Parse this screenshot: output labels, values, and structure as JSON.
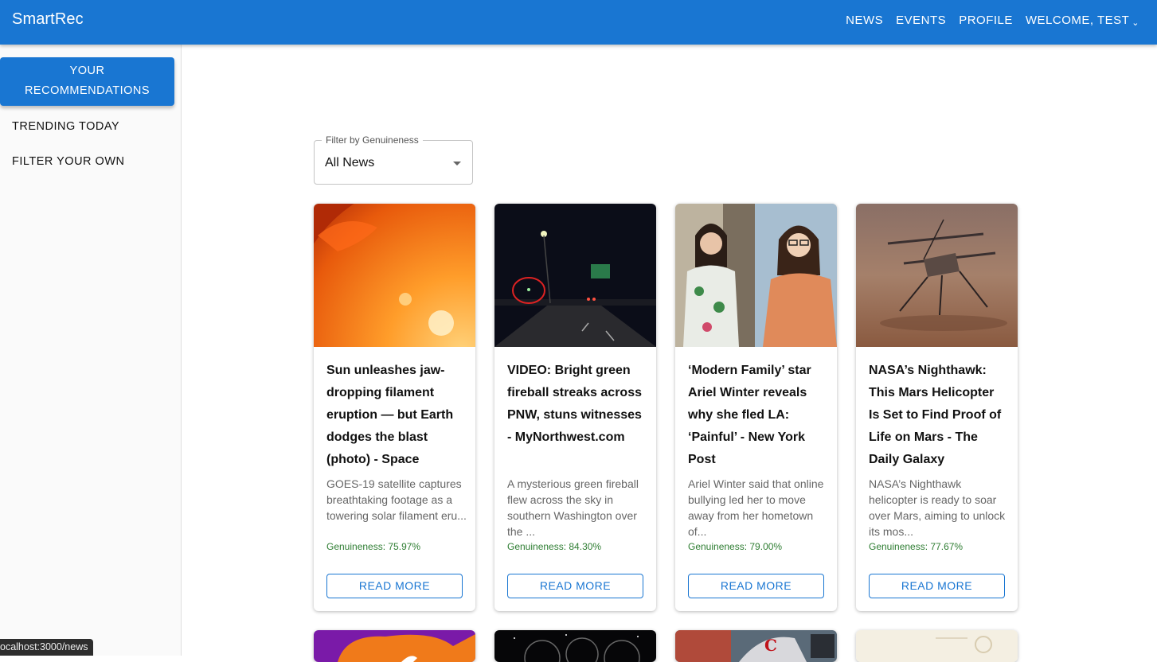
{
  "app": {
    "brand": "SmartRec"
  },
  "nav": {
    "news": "NEWS",
    "events": "EVENTS",
    "profile": "PROFILE",
    "welcome": "WELCOME, TEST"
  },
  "sidebar": {
    "active_line1": "YOUR",
    "active_line2": "RECOMMENDATIONS",
    "trending": "TRENDING TODAY",
    "filter_own": "FILTER YOUR OWN"
  },
  "filter": {
    "label": "Filter by Genuineness",
    "value": "All News"
  },
  "cards": [
    {
      "title": "Sun unleashes jaw-dropping filament eruption — but Earth dodges the blast (photo) - Space",
      "desc": "GOES-19 satellite captures breathtaking footage as a towering solar filament eru...",
      "score": "Genuineness: 75.97%",
      "button": "READ MORE"
    },
    {
      "title": "VIDEO: Bright green fireball streaks across PNW, stuns witnesses - MyNorthwest.com",
      "desc": "A mysterious green fireball flew across the sky in southern Washington over the ...",
      "score": "Genuineness: 84.30%",
      "button": "READ MORE"
    },
    {
      "title": "‘Modern Family’ star Ariel Winter reveals why she fled LA: ‘Painful’ - New York Post",
      "desc": "Ariel Winter said that online bullying led her to move away from her hometown of...",
      "score": "Genuineness: 79.00%",
      "button": "READ MORE"
    },
    {
      "title": "NASA’s Nighthawk: This Mars Helicopter Is Set to Find Proof of Life on Mars - The Daily Galaxy",
      "desc": "NASA’s Nighthawk helicopter is ready to soar over Mars, aiming to unlock its mos...",
      "score": "Genuineness: 77.67%",
      "button": "READ MORE"
    }
  ],
  "statusbar": {
    "url": "ocalhost:3000/news"
  },
  "colors": {
    "primary": "#1976d2",
    "genuine_green": "#2e7d32"
  }
}
